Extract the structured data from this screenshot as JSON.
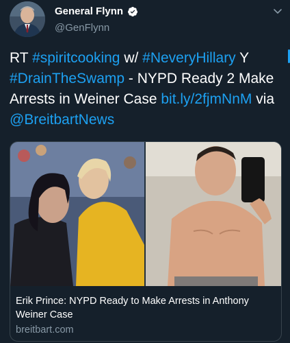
{
  "author": {
    "display_name": "General Flynn",
    "handle": "@GenFlynn",
    "verified": true
  },
  "tweet": {
    "segments": [
      {
        "text": "RT ",
        "link": false
      },
      {
        "text": "#spiritcooking",
        "link": true
      },
      {
        "text": " w/ ",
        "link": false
      },
      {
        "text": "#NeveryHillary",
        "link": true
      },
      {
        "text": " Y ",
        "link": false
      },
      {
        "text": "#DrainTheSwamp",
        "link": true
      },
      {
        "text": " - NYPD Ready 2 Make Arrests in Weiner Case ",
        "link": false
      },
      {
        "text": "bit.ly/2fjmNnM",
        "link": true
      },
      {
        "text": " via ",
        "link": false
      },
      {
        "text": "@BreitbartNews",
        "link": true
      }
    ]
  },
  "card": {
    "title": "Erik Prince: NYPD Ready to Make Arrests in Anthony Weiner Case",
    "domain": "breitbart.com"
  },
  "colors": {
    "background": "#15202b",
    "link": "#1da1f2",
    "secondary_text": "#8899a6",
    "border": "#38444d"
  },
  "icons": {
    "verified": "verified-badge-icon",
    "menu": "chevron-down-icon"
  }
}
